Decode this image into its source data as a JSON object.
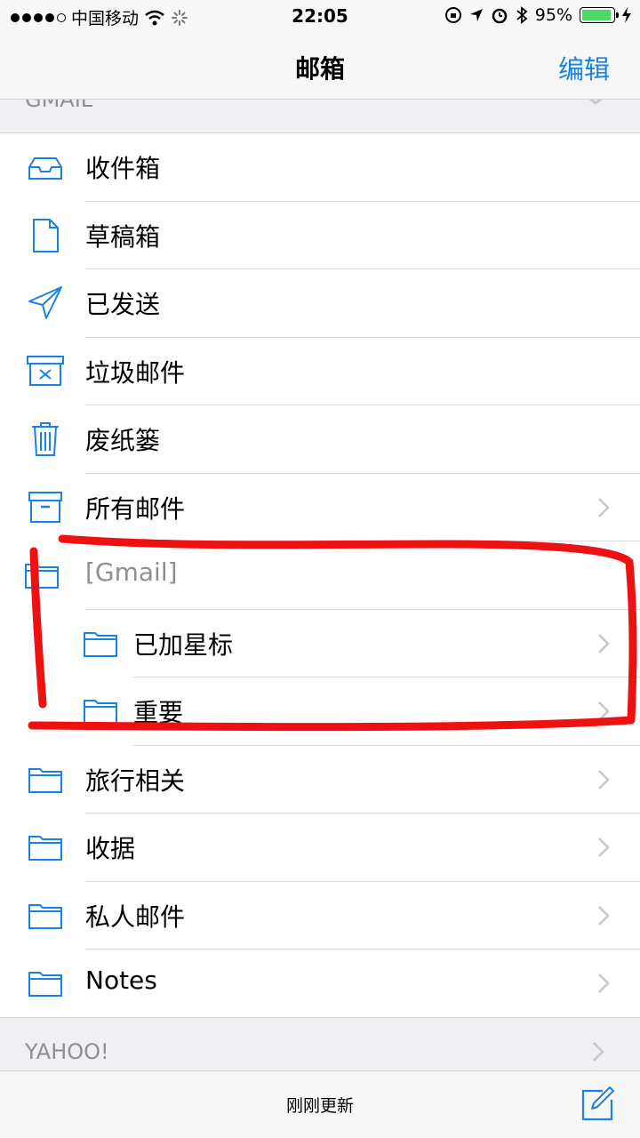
{
  "status_bar": {
    "carrier": "中国移动",
    "time": "22:05",
    "battery_percent": "95%",
    "battery_level": 0.95
  },
  "nav": {
    "title": "邮箱",
    "edit_label": "编辑"
  },
  "sections": {
    "gmail_header": "GMAIL",
    "yahoo_header": "YAHOO!"
  },
  "folders": [
    {
      "label": "收件箱",
      "icon": "inbox-icon",
      "chevron": false
    },
    {
      "label": "草稿箱",
      "icon": "draft-icon",
      "chevron": false
    },
    {
      "label": "已发送",
      "icon": "sent-icon",
      "chevron": false
    },
    {
      "label": "垃圾邮件",
      "icon": "junk-icon",
      "chevron": false
    },
    {
      "label": "废纸篓",
      "icon": "trash-icon",
      "chevron": false
    },
    {
      "label": "所有邮件",
      "icon": "archive-icon",
      "chevron": true
    },
    {
      "label": "[Gmail]",
      "icon": "folder-icon",
      "chevron": false
    },
    {
      "label": "已加星标",
      "icon": "folder-icon",
      "chevron": true
    },
    {
      "label": "重要",
      "icon": "folder-icon",
      "chevron": true
    },
    {
      "label": "旅行相关",
      "icon": "folder-icon",
      "chevron": true
    },
    {
      "label": "收据",
      "icon": "folder-icon",
      "chevron": true
    },
    {
      "label": "私人邮件",
      "icon": "folder-icon",
      "chevron": true
    },
    {
      "label": "Notes",
      "icon": "folder-icon",
      "chevron": true
    }
  ],
  "toolbar": {
    "updated_text": "刚刚更新"
  },
  "colors": {
    "accent": "#1a82e2",
    "highlight": "#ee1111"
  }
}
